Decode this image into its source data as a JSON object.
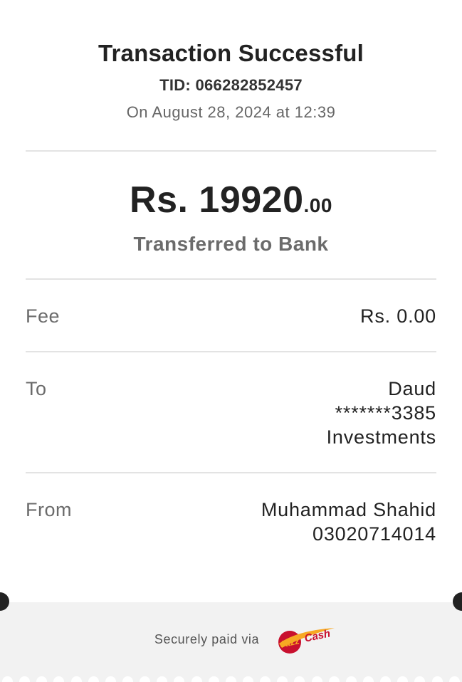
{
  "header": {
    "title": "Transaction Successful",
    "tid": "TID: 066282852457",
    "datetime": "On August 28, 2024 at 12:39"
  },
  "amount": {
    "main": "Rs. 19920",
    "cents": ".00",
    "type": "Transferred to Bank"
  },
  "fee": {
    "label": "Fee",
    "value": "Rs. 0.00"
  },
  "to": {
    "label": "To",
    "lines": [
      "Daud",
      "*******3385",
      "Investments"
    ]
  },
  "from": {
    "label": "From",
    "lines": [
      "Muhammad Shahid",
      "03020714014"
    ]
  },
  "footer": {
    "secure_text": "Securely paid via",
    "logo_icon": "jazzcash-logo-icon",
    "logo_text_1": "Jazz",
    "logo_text_2": "Cash",
    "background": "#f2f2f2"
  },
  "colors": {
    "text_primary": "#222222",
    "text_secondary": "#6b6b6b",
    "divider": "#e3e3e3",
    "brand_red": "#c8102e",
    "brand_orange": "#f7a823"
  }
}
